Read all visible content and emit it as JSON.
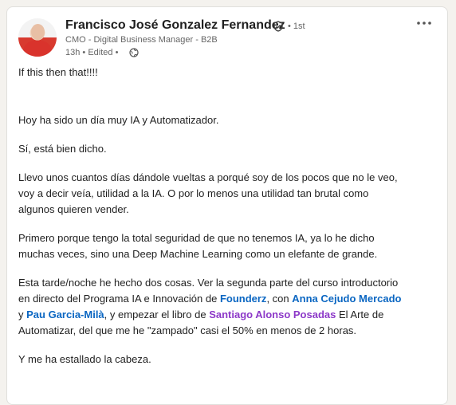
{
  "post": {
    "author": {
      "name": "Francisco José Gonzalez Fernandez",
      "degree": "• 1st",
      "headline": "CMO - Digital Business Manager - B2B",
      "timestamp": "13h • Edited •"
    },
    "icons": {
      "verified": "verified-shield-icon",
      "visibility": "globe-icon",
      "more": "more-options-icon"
    },
    "colors": {
      "link_blue": "#0a66c2",
      "link_purple": "#8c38c8",
      "text": "#1f1f1f",
      "meta": "#666666"
    },
    "body": {
      "p1": "If this then that!!!!",
      "p2": "Hoy ha sido un día muy IA y Automatizador.",
      "p3": "Sí, está bien dicho.",
      "p4_l1": "Llevo unos cuantos días dándole vueltas a porqué soy de los pocos que no le veo,",
      "p4_l2": "voy a decir veía, utilidad a la IA. O por lo menos una utilidad tan brutal como",
      "p4_l3": "algunos quieren vender.",
      "p5_l1": "Primero porque tengo la total seguridad de que no tenemos IA, ya lo he dicho",
      "p5_l2": "muchas veces, sino una Deep Machine Learning como un elefante de grande.",
      "p6_l1": "Esta tarde/noche he hecho dos cosas. Ver la segunda parte del curso introductorio",
      "p6_l2_a": "en directo del Programa IA e Innovación de ",
      "p6_l2_link1": "Founderz",
      "p6_l2_b": ", con ",
      "p6_l2_link2": "Anna Cejudo Mercado",
      "p6_l3_a": " y ",
      "p6_l3_link3": "Pau Garcia-Milà",
      "p6_l3_b": ", y empezar el libro de ",
      "p6_l3_link4": "Santiago Alonso Posadas",
      "p6_l3_c": " El Arte de",
      "p6_l4": "Automatizar, del que me he \"zampado\" casi el 50% en menos de 2 horas.",
      "p7": "Y me ha estallado la cabeza."
    }
  }
}
